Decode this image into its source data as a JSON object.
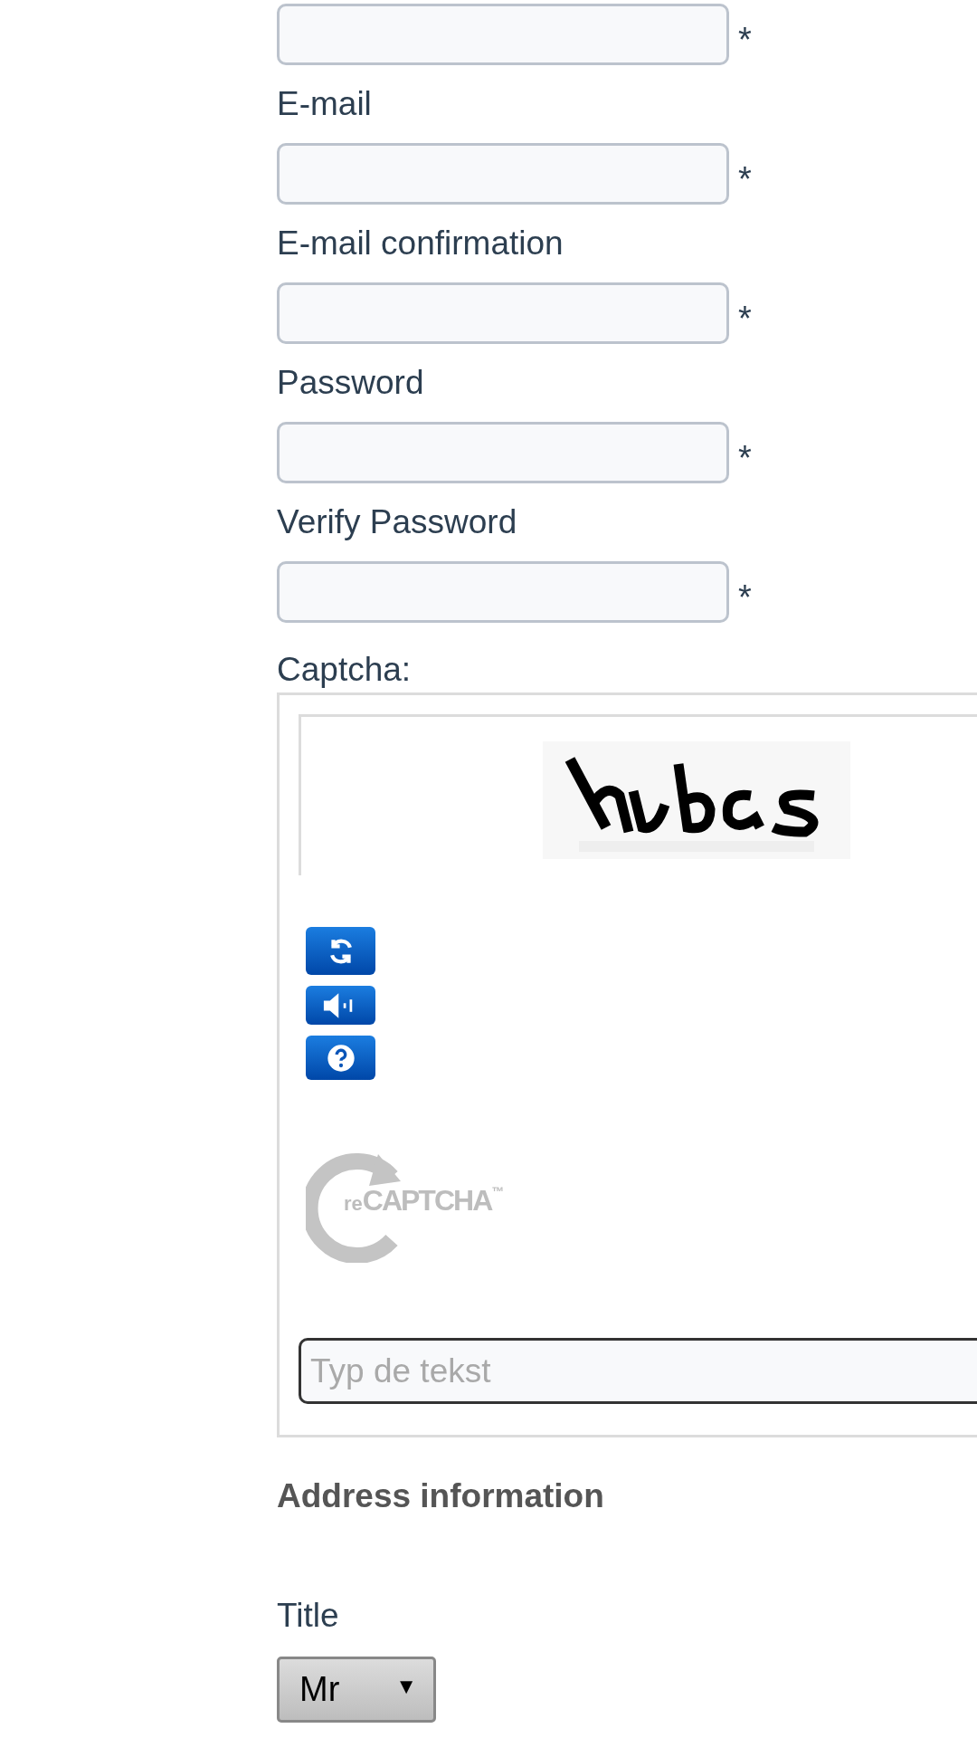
{
  "top_field": {
    "required_mark": "*"
  },
  "fields": [
    {
      "label": "E-mail",
      "required_mark": "*"
    },
    {
      "label": "E-mail confirmation",
      "required_mark": "*"
    },
    {
      "label": "Password",
      "required_mark": "*"
    },
    {
      "label": "Verify Password",
      "required_mark": "*"
    }
  ],
  "captcha": {
    "label": "Captcha:",
    "logo": {
      "prefix": "re",
      "name": "CAPTCHA",
      "trademark": "™"
    },
    "answer": {
      "placeholder": "Typ de tekst"
    }
  },
  "address": {
    "heading": "Address information",
    "title": {
      "label": "Title",
      "value": "Mr",
      "caret": "▼"
    }
  }
}
